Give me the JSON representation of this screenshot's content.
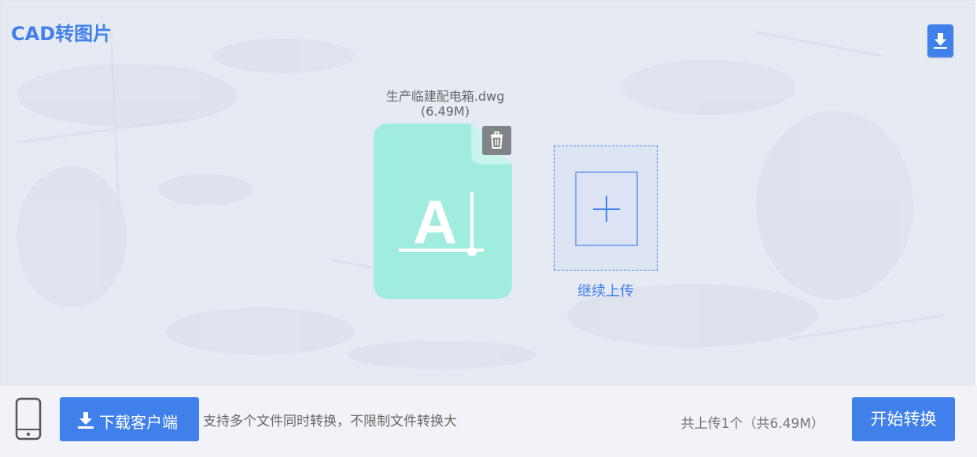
{
  "app": {
    "title": "CAD转图片"
  },
  "file": {
    "name": "生产临建配电箱.dwg",
    "size": "(6.49M)",
    "icon": "cad-file-icon"
  },
  "upload": {
    "continue_label": "继续上传"
  },
  "footer": {
    "download_client_label": "下载客户端",
    "support_text": "支持多个文件同时转换，不限制文件转换大",
    "summary": "共上传1个（共6.49M）",
    "start_label": "开始转换"
  },
  "colors": {
    "accent": "#3f80ea",
    "file_card": "#a0ede0",
    "background": "#e6eaf3"
  }
}
